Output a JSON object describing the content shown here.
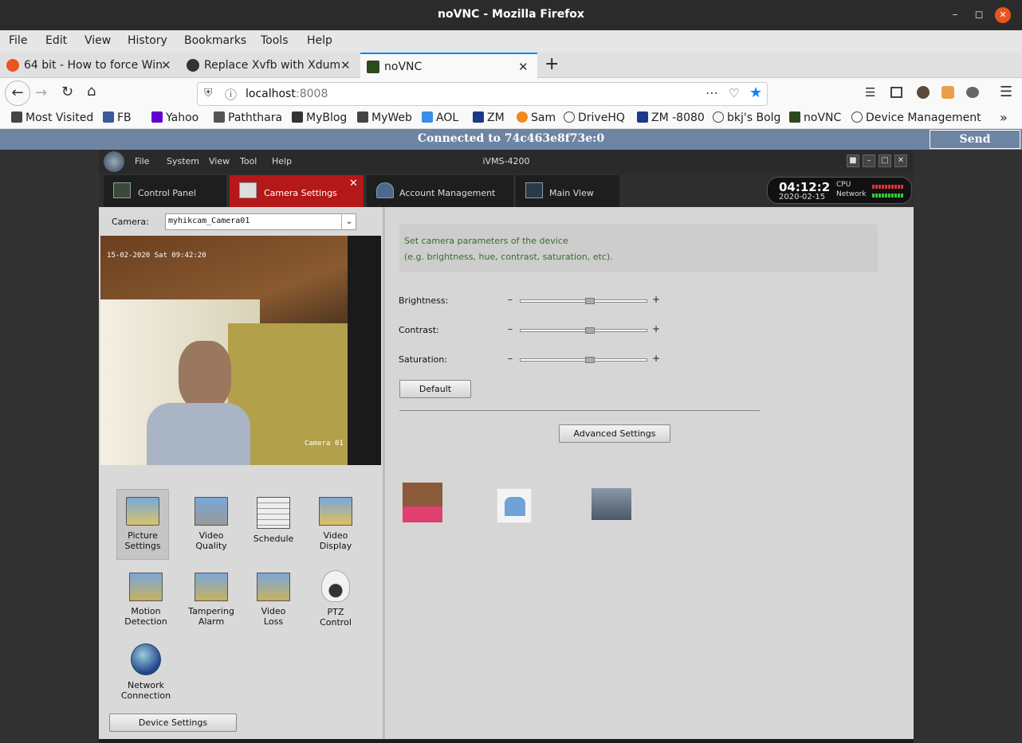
{
  "window": {
    "title": "noVNC - Mozilla Firefox"
  },
  "menu": [
    "File",
    "Edit",
    "View",
    "History",
    "Bookmarks",
    "Tools",
    "Help"
  ],
  "tabs": [
    {
      "label": "64 bit - How to force Win",
      "color": "#e95420"
    },
    {
      "label": "Replace Xvfb with Xdum",
      "color": "#333333"
    },
    {
      "label": "noVNC",
      "color": "#2d4a1e"
    }
  ],
  "address": {
    "host": "localhost",
    "port": ":8008"
  },
  "bookmarks": [
    {
      "label": "Most Visited",
      "color": "#444444"
    },
    {
      "label": "FB",
      "color": "#3b5998"
    },
    {
      "label": "Yahoo",
      "color": "#6001d2"
    },
    {
      "label": "Paththara",
      "color": "#555555"
    },
    {
      "label": "MyBlog",
      "color": "#333333"
    },
    {
      "label": "MyWeb",
      "color": "#444444"
    },
    {
      "label": "AOL",
      "color": "#3a8ee6"
    },
    {
      "label": "ZM",
      "color": "#1a3a8a"
    },
    {
      "label": "Sam",
      "color": "#f08a1c"
    },
    {
      "label": "DriveHQ",
      "color": "#444444"
    },
    {
      "label": "ZM -8080",
      "color": "#1a3a8a"
    },
    {
      "label": "bkj's Bolg",
      "color": "#444444"
    },
    {
      "label": "noVNC",
      "color": "#2d4a1e"
    },
    {
      "label": "Device Management",
      "color": "#444444"
    }
  ],
  "vnc": {
    "status": "Connected to 74c463e8f73e:0",
    "cad": "Send CtrlAltDel"
  },
  "app": {
    "menu": [
      "File",
      "System",
      "View",
      "Tool",
      "Help"
    ],
    "title": "iVMS-4200",
    "tabs": [
      "Control Panel",
      "Camera Settings",
      "Account Management",
      "Main View"
    ],
    "clock": {
      "time": "04:12:2",
      "date": "2020-02-15",
      "cpu": "CPU",
      "network": "Network"
    },
    "camera_label": "Camera:",
    "camera_value": "myhikcam_Camera01",
    "osd_time": "15-02-2020 Sat 09:42:20",
    "osd_name": "Camera 01",
    "tools": [
      {
        "line1": "Picture",
        "line2": "Settings"
      },
      {
        "line1": "Video",
        "line2": "Quality"
      },
      {
        "line1": "Schedule",
        "line2": ""
      },
      {
        "line1": "Video",
        "line2": "Display"
      },
      {
        "line1": "Motion",
        "line2": "Detection"
      },
      {
        "line1": "Tampering",
        "line2": "Alarm"
      },
      {
        "line1": "Video",
        "line2": "Loss"
      },
      {
        "line1": "PTZ",
        "line2": "Control"
      },
      {
        "line1": "Network",
        "line2": "Connection"
      }
    ],
    "device_settings": "Device Settings",
    "info": {
      "line1": "Set camera parameters of the device",
      "line2": "(e.g. brightness, hue, contrast, saturation, etc)."
    },
    "sliders": [
      {
        "label": "Brightness:",
        "value": 0.55
      },
      {
        "label": "Contrast:",
        "value": 0.55
      },
      {
        "label": "Saturation:",
        "value": 0.55
      }
    ],
    "minus": "–",
    "plus": "+",
    "default_btn": "Default",
    "advanced_btn": "Advanced Settings"
  }
}
